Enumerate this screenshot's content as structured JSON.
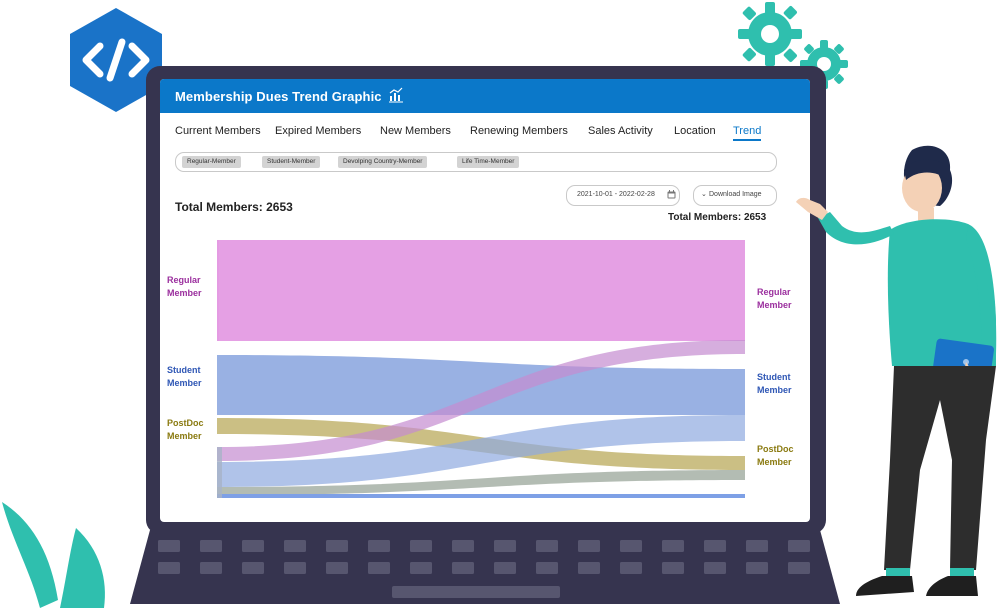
{
  "window": {
    "title": "Membership Dues Trend Graphic"
  },
  "tabs": [
    {
      "label": "Current Members",
      "active": false
    },
    {
      "label": "Expired Members",
      "active": false
    },
    {
      "label": "New Members",
      "active": false
    },
    {
      "label": "Renewing Members",
      "active": false
    },
    {
      "label": "Sales Activity",
      "active": false
    },
    {
      "label": "Location",
      "active": false
    },
    {
      "label": "Trend",
      "active": true
    }
  ],
  "filters": {
    "chips": [
      "Regular-Member",
      "Student-Member",
      "Devolping Country-Member",
      "Life Time-Member"
    ]
  },
  "controls": {
    "date_range": "2021-10-01 - 2022-02-28",
    "download_label": "Download Image"
  },
  "totals": {
    "left": "Total Members: 2653",
    "right": "Total Members: 2653"
  },
  "sankey": {
    "left_nodes": [
      {
        "label": "Regular Member"
      },
      {
        "label": "Student Member"
      },
      {
        "label": "PostDoc Member"
      }
    ],
    "right_nodes": [
      {
        "label": "Regular Member"
      },
      {
        "label": "Student Member"
      },
      {
        "label": "PostDoc Member"
      }
    ]
  },
  "colors": {
    "accent": "#0b78c9",
    "regular": "#e49be3",
    "student": "#8ea9e0",
    "postdoc": "#c2b46e",
    "regular_label": "#9b2f9e",
    "student_label": "#2f57b5",
    "postdoc_label": "#8a7a10",
    "laptop": "#36344f",
    "teal": "#2fbfae",
    "badge": "#1a73c8"
  },
  "icons": {
    "code_badge": "code-icon",
    "gears": "gear-icon",
    "chart": "chart-icon",
    "calendar": "calendar-icon",
    "chevron": "chevron-down-icon"
  }
}
